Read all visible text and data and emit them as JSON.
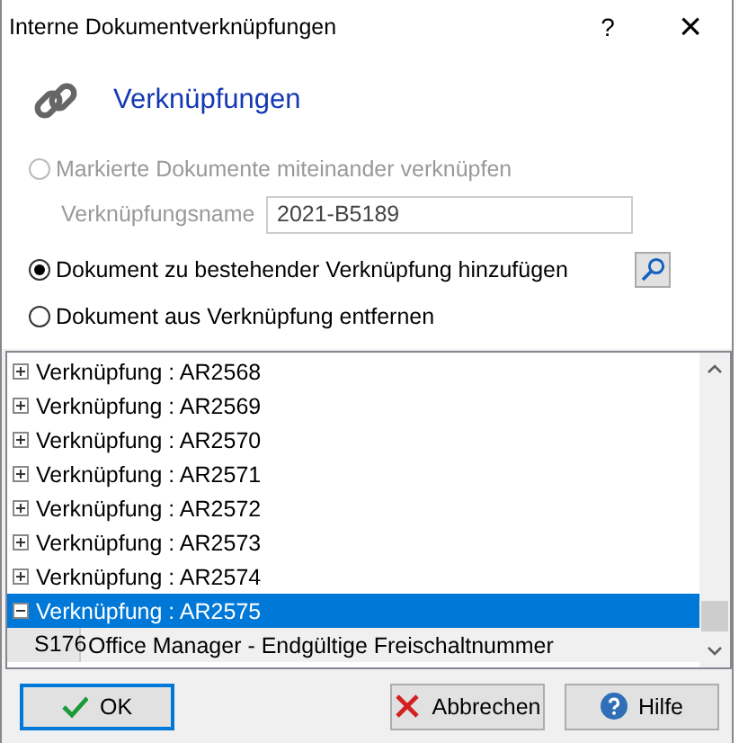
{
  "window": {
    "title": "Interne Dokumentverknüpfungen",
    "help": "?",
    "close": "×"
  },
  "header": {
    "title": "Verknüpfungen"
  },
  "options": [
    {
      "kind": "radio",
      "label": "Markierte Dokumente miteinander verknüpfen",
      "selected": false,
      "disabled": true
    },
    {
      "kind": "field",
      "label": "Verknüpfungsname",
      "value": "2021-B5189",
      "disabled": true
    },
    {
      "kind": "radio-search",
      "label": "Dokument zu bestehender Verknüpfung hinzufügen",
      "selected": true,
      "disabled": false
    },
    {
      "kind": "radio",
      "label": "Dokument aus Verknüpfung entfernen",
      "selected": false,
      "disabled": false
    }
  ],
  "tree": {
    "items": [
      {
        "label": "Verknüpfung : AR2568",
        "expanded": false,
        "selected": false
      },
      {
        "label": "Verknüpfung : AR2569",
        "expanded": false,
        "selected": false
      },
      {
        "label": "Verknüpfung : AR2570",
        "expanded": false,
        "selected": false
      },
      {
        "label": "Verknüpfung : AR2571",
        "expanded": false,
        "selected": false
      },
      {
        "label": "Verknüpfung : AR2572",
        "expanded": false,
        "selected": false
      },
      {
        "label": "Verknüpfung : AR2573",
        "expanded": false,
        "selected": false
      },
      {
        "label": "Verknüpfung : AR2574",
        "expanded": false,
        "selected": false
      },
      {
        "label": "Verknüpfung : AR2575",
        "expanded": true,
        "selected": true,
        "children": [
          {
            "code": "S176",
            "label": "Office Manager - Endgültige Freischaltnummer"
          }
        ]
      }
    ]
  },
  "buttons": [
    {
      "kind": "ok",
      "label": "OK",
      "focused": true
    },
    {
      "kind": "cancel",
      "label": "Abbrechen",
      "focused": false
    },
    {
      "kind": "help",
      "label": "Hilfe",
      "focused": false
    }
  ]
}
